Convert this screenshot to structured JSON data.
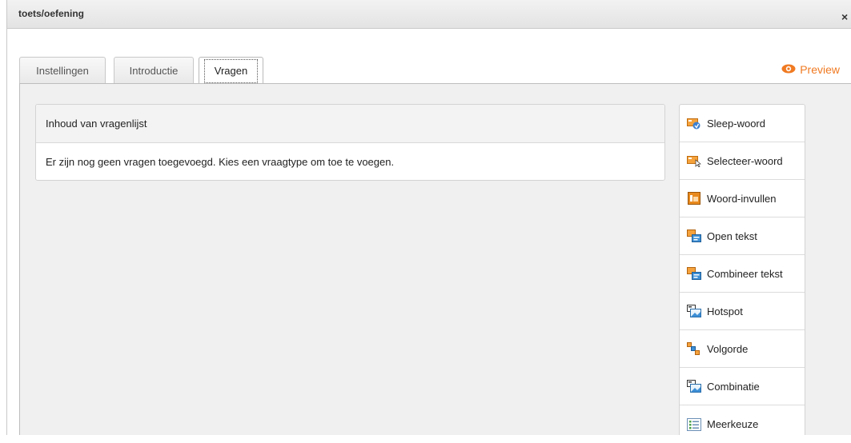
{
  "window": {
    "title": "toets/oefening",
    "close_label": "×"
  },
  "tabs": [
    {
      "label": "Instellingen",
      "active": false
    },
    {
      "label": "Introductie",
      "active": false
    },
    {
      "label": "Vragen",
      "active": true
    }
  ],
  "preview": {
    "label": "Preview",
    "icon": "eye-icon",
    "color": "#f07a22"
  },
  "question_list": {
    "header": "Inhoud van vragenlijst",
    "empty_message": "Er zijn nog geen vragen toegevoegd. Kies een vraagtype om toe te voegen."
  },
  "question_types": [
    {
      "label": "Sleep-woord",
      "icon": "drag-word-icon"
    },
    {
      "label": "Selecteer-woord",
      "icon": "select-word-icon"
    },
    {
      "label": "Woord-invullen",
      "icon": "fill-word-icon"
    },
    {
      "label": "Open tekst",
      "icon": "open-text-icon"
    },
    {
      "label": "Combineer tekst",
      "icon": "combine-text-icon"
    },
    {
      "label": "Hotspot",
      "icon": "hotspot-icon"
    },
    {
      "label": "Volgorde",
      "icon": "order-icon"
    },
    {
      "label": "Combinatie",
      "icon": "combination-icon"
    },
    {
      "label": "Meerkeuze",
      "icon": "multiple-choice-icon"
    }
  ]
}
